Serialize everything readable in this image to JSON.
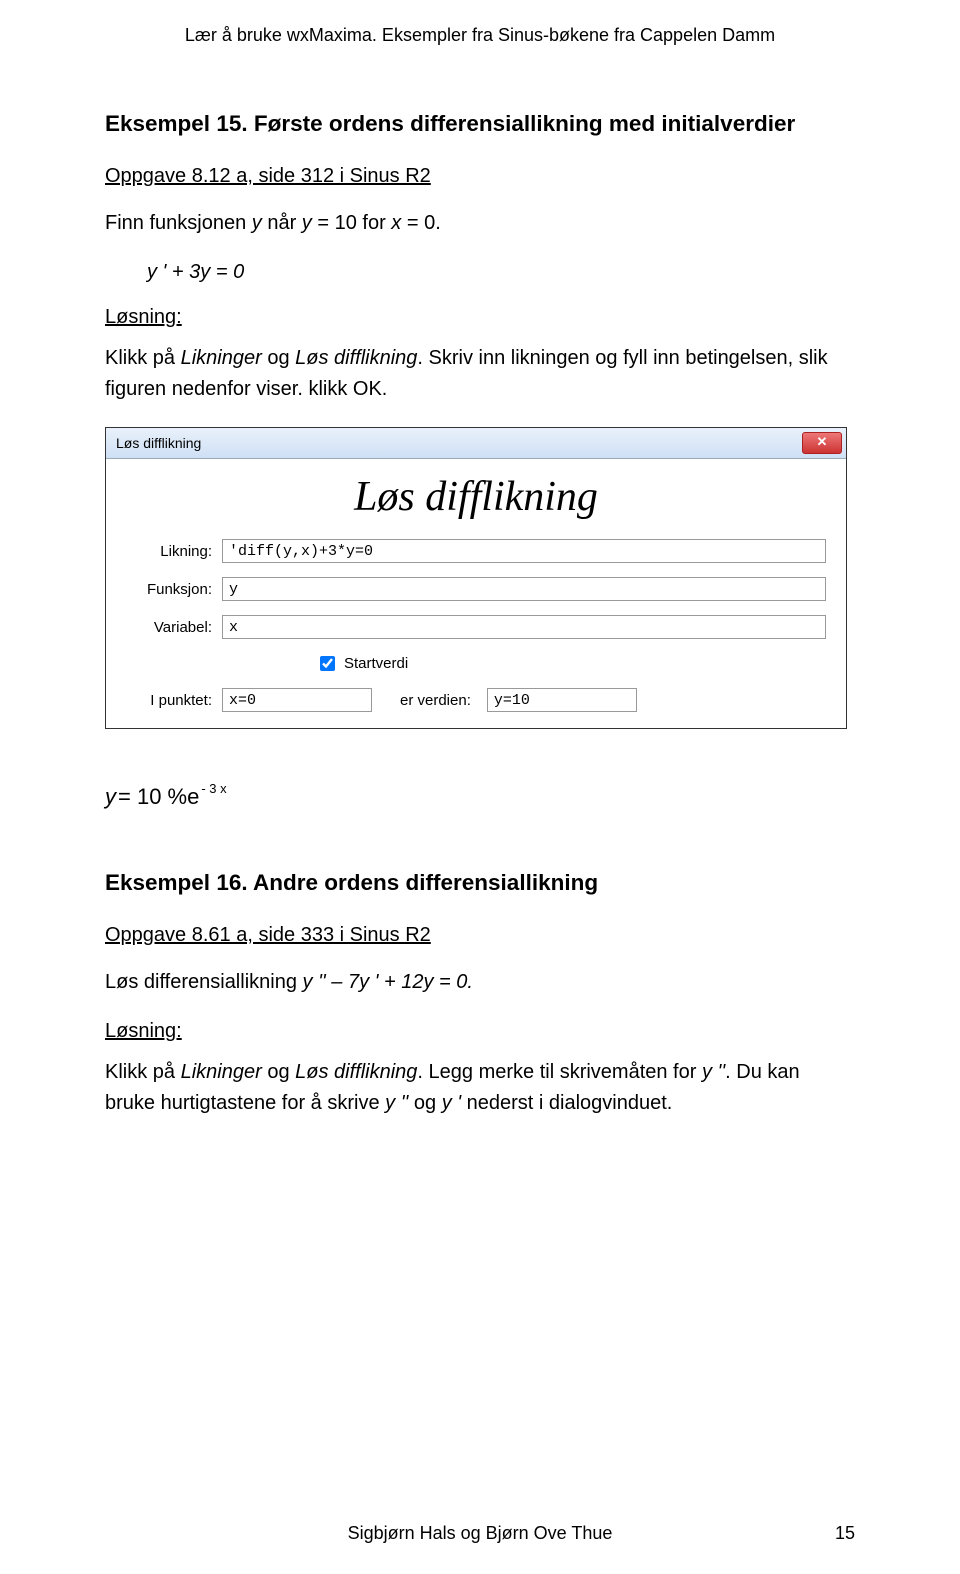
{
  "running_header": "Lær å bruke wxMaxima. Eksempler fra Sinus-bøkene fra Cappelen Damm",
  "ex15": {
    "title": "Eksempel 15. Første ordens differensiallikning med initialverdier",
    "oppgave": "Oppgave 8.12 a, side 312 i Sinus R2",
    "finnLine_pre": "Finn funksjonen ",
    "finnLine_var1": "y",
    "finnLine_mid": " når ",
    "finnLine_var2": "y",
    "finnLine_eq": " = 10 for ",
    "finnLine_var3": "x",
    "finnLine_post": " = 0.",
    "equation": "y ' + 3y = 0",
    "losning_label": "Løsning:",
    "losning_text": "Klikk på Likninger og Løs difflikning. Skriv inn likningen og fyll inn betingelsen, slik figuren nedenfor viser. klikk OK."
  },
  "dialog": {
    "titlebar": "Løs difflikning",
    "close_glyph": "✕",
    "big_title": "Løs difflikning",
    "label_likning": "Likning:",
    "val_likning": "'diff(y,x)+3*y=0",
    "label_funksjon": "Funksjon:",
    "val_funksjon": "y",
    "label_variabel": "Variabel:",
    "val_variabel": "x",
    "checkbox_label": "Startverdi",
    "checkbox_checked": true,
    "label_ipunkt": "I punktet:",
    "val_ipunkt": "x=0",
    "label_erverdien": "er verdien:",
    "val_erverdien": "y=10"
  },
  "result": {
    "y": "y",
    "eq": " = 10 %e",
    "exp": "- 3 x"
  },
  "ex16": {
    "title": "Eksempel 16. Andre ordens differensiallikning",
    "oppgave": "Oppgave 8.61 a, side 333 i Sinus R2",
    "problem_pre": "Løs differensiallikning ",
    "problem_eq": "y '' – 7y ' + 12y = 0.",
    "losning_label": "Løsning:",
    "losning_text_pre": "Klikk på Likninger og Løs difflikning. Legg merke til skrivemåten for ",
    "losning_text_var": "y ''",
    "losning_text_mid": ". Du kan bruke hurtigtastene for å skrive ",
    "losning_text_var2": "y ''",
    "losning_text_and": " og ",
    "losning_text_var3": "y '",
    "losning_text_post": " nederst i dialogvinduet."
  },
  "footer_text": "Sigbjørn Hals og Bjørn Ove Thue",
  "page_number": "15"
}
